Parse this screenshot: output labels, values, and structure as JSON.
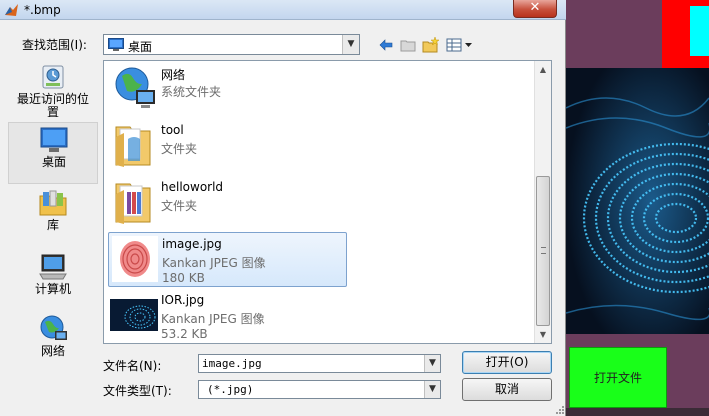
{
  "background": {
    "button_label": "打开文件"
  },
  "dialog": {
    "title": "*.bmp",
    "close_label": "✕",
    "look_in_label": "查找范围(I):",
    "look_in_value": "桌面",
    "toolbar": {
      "back_icon": "back-arrow-icon",
      "up_icon": "up-folder-icon",
      "new_folder_icon": "new-folder-icon",
      "view_icon": "view-menu-icon"
    },
    "places": [
      {
        "label": "最近访问的位置",
        "icon": "recent-places-icon"
      },
      {
        "label": "桌面",
        "icon": "desktop-icon"
      },
      {
        "label": "库",
        "icon": "libraries-icon"
      },
      {
        "label": "计算机",
        "icon": "computer-icon"
      },
      {
        "label": "网络",
        "icon": "network-icon"
      }
    ],
    "files": [
      {
        "name": "网络",
        "type": "系统文件夹",
        "size": "",
        "icon": "network-icon"
      },
      {
        "name": "tool",
        "type": "文件夹",
        "size": "",
        "icon": "folder-icon"
      },
      {
        "name": "helloworld",
        "type": "文件夹",
        "size": "",
        "icon": "folder-icon"
      },
      {
        "name": "image.jpg",
        "type": "Kankan JPEG 图像",
        "size": "180 KB",
        "icon": "fingerprint-thumbnail-icon",
        "selected": true
      },
      {
        "name": "IOR.jpg",
        "type": "Kankan JPEG 图像",
        "size": "53.2 KB",
        "icon": "fingerprint-thumbnail-icon"
      }
    ],
    "file_name_label": "文件名(N):",
    "file_name_value": "image.jpg",
    "file_type_label": "文件类型(T):",
    "file_type_value": "(*.jpg)",
    "open_label": "打开(O)",
    "cancel_label": "取消"
  }
}
